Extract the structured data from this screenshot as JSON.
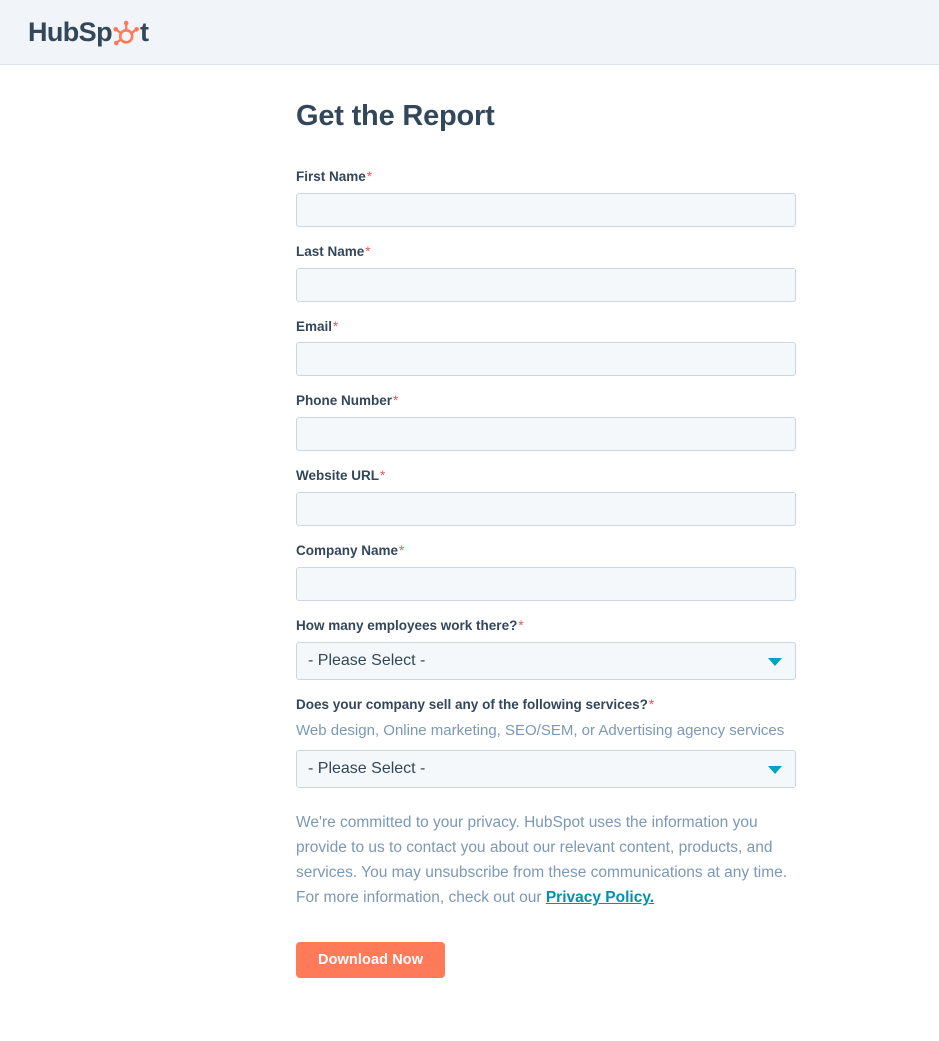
{
  "header": {
    "logo_text_start": "HubSp",
    "logo_icon": "hubspot-sprocket-icon",
    "logo_text_end": "t",
    "logo_color": "#33475b",
    "logo_accent_color": "#ff7a59",
    "background": "#f1f4f8"
  },
  "form": {
    "title": "Get the Report",
    "required_marker": "*",
    "fields": [
      {
        "label": "First Name",
        "required": true,
        "type": "text",
        "value": "",
        "placeholder": ""
      },
      {
        "label": "Last Name",
        "required": true,
        "type": "text",
        "value": "",
        "placeholder": ""
      },
      {
        "label": "Email",
        "required": true,
        "type": "text",
        "value": "",
        "placeholder": ""
      },
      {
        "label": "Phone Number",
        "required": true,
        "type": "text",
        "value": "",
        "placeholder": ""
      },
      {
        "label": "Website URL",
        "required": true,
        "type": "text",
        "value": "",
        "placeholder": ""
      },
      {
        "label": "Company Name",
        "required": true,
        "type": "text",
        "value": "",
        "placeholder": ""
      }
    ],
    "selects": [
      {
        "label": "How many employees work there?",
        "required": true,
        "description": "",
        "value": "- Please Select -"
      },
      {
        "label": "Does your company sell any of the following services?",
        "required": true,
        "description": "Web design, Online marketing, SEO/SEM, or Advertising agency services",
        "value": "- Please Select -"
      }
    ],
    "legal": {
      "text_before_link": "We're committed to your privacy. HubSpot uses the information you provide to us to contact you about our relevant content, products, and services. You may unsubscribe from these communications at any time. For more information, check out our ",
      "link_text": "Privacy Policy.",
      "link_color": "#0091ae"
    },
    "submit": {
      "label": "Download Now",
      "background": "#ff7a59",
      "text_color": "#ffffff"
    },
    "caret_color": "#00a4bd",
    "required_color": "#f2545b",
    "input_background": "#f5f8fa",
    "input_border": "#cbd6e2"
  }
}
